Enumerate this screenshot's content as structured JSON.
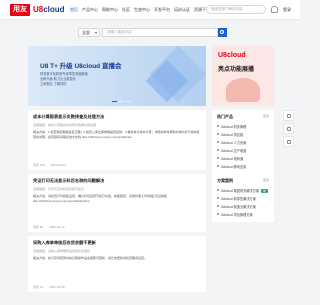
{
  "header": {
    "logo_mark": "用友",
    "logo_text_left": "U8",
    "logo_text_right": "cloud",
    "nav": [
      "首页",
      "产品中心",
      "帮助中心",
      "社区",
      "生态中心",
      "开发平台",
      "培训认证",
      "资源下载",
      "服务中心"
    ],
    "search_placeholder": "搜索您想了解的内容",
    "login_label": "登录"
  },
  "search": {
    "scope_label": "全部",
    "placeholder": "请输入搜索内容"
  },
  "banner": {
    "title": "U8 T+ 升级 U8cloud 直播会",
    "line1": "财务数字化转型专家带您深度解读",
    "line2": "全新升级 助力企业数智化",
    "line3": "立即报名 了解详情"
  },
  "ad": {
    "logo": "U8cloud",
    "title": "亮点功能展播"
  },
  "feed": [
    {
      "title": "成本计算报表显示负数排查及处理方法",
      "meta": "问题描述：成本计算报表中出现负数单价的处理",
      "body": "解决方案：1.检查期初数据是否正确；2.检查入库出库单据是否完整；3.重新执行成本计算；详细请参考帮助文档中关于成本核算的说明，如有疑问请联系技术支持 http://u8cloud.yonyou.com/portal/help",
      "views": "浏览 128",
      "date": "2023-04-12"
    },
    {
      "title": "凭证打印无法显示科目名称的问题解决",
      "meta": "问题描述：打印凭证时科目名称不显示",
      "body": "解决方案：请检查打印模板设置，确认科目名称字段已勾选，模板路径：系统管理-打印模板-凭证模板 http://u8cloud.yonyou.com/portal/help/print",
      "views": "浏览 96",
      "date": "2023-04-10"
    },
    {
      "title": "采购入库单审核后存货余额不更新",
      "meta": "问题描述：采购入库单审核后余额表未更新",
      "body": "解决方案：执行存货核算中的记账操作后余额即可更新，如仍未更新请检查期间设置。",
      "views": "浏览 74",
      "date": "2023-04-08"
    }
  ],
  "sidebar": {
    "hot_title": "热门产品",
    "more_label": "更多",
    "hot_items": [
      "U8cloud 财务管理",
      "U8cloud 供应链",
      "U8cloud 人力资源",
      "U8cloud 生产制造",
      "U8cloud 电商通",
      "U8cloud 移动应用"
    ],
    "solution_title": "方案案例",
    "solution_items": [
      "U8cloud 集团财务解决方案",
      "U8cloud 新零售解决方案",
      "U8cloud 制造业解决方案",
      "U8cloud 项目管理方案"
    ],
    "new_badge": "新"
  }
}
